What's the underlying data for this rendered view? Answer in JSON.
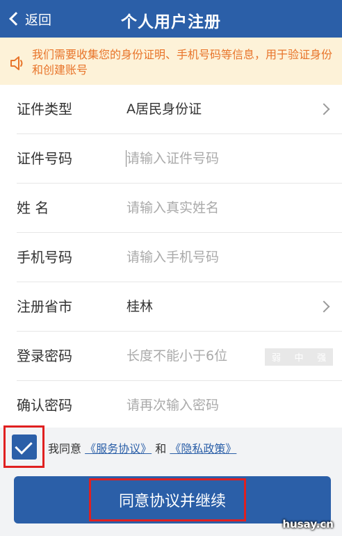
{
  "header": {
    "back_label": "返回",
    "title": "个人用户注册"
  },
  "notice": {
    "text": "我们需要收集您的身份证明、手机号码等信息，用于验证身份和创建账号",
    "icon": "speaker-icon",
    "color": "#e8742a"
  },
  "form": {
    "rows": [
      {
        "label": "证件类型",
        "value": "A居民身份证"
      },
      {
        "label": "证件号码",
        "placeholder": "请输入证件号码"
      },
      {
        "label": "姓 名",
        "placeholder": "请输入真实姓名"
      },
      {
        "label": "手机号码",
        "placeholder": "请输入手机号码"
      },
      {
        "label": "注册省市",
        "value": "桂林"
      },
      {
        "label": "登录密码",
        "placeholder": "长度不能小于6位"
      },
      {
        "label": "确认密码",
        "placeholder": "请再次输入密码"
      }
    ],
    "strength": {
      "weak": "弱",
      "medium": "中",
      "strong": "强"
    }
  },
  "agreement": {
    "checked": true,
    "prefix": "我同意",
    "service_link": "《服务协议》",
    "and": "和",
    "privacy_link": "《隐私政策》"
  },
  "continue_button": "同意协议并继续",
  "watermark": "husay.cn",
  "colors": {
    "primary": "#2b5fa8",
    "notice_bg": "#fdf2d8",
    "highlight": "#e02020"
  }
}
